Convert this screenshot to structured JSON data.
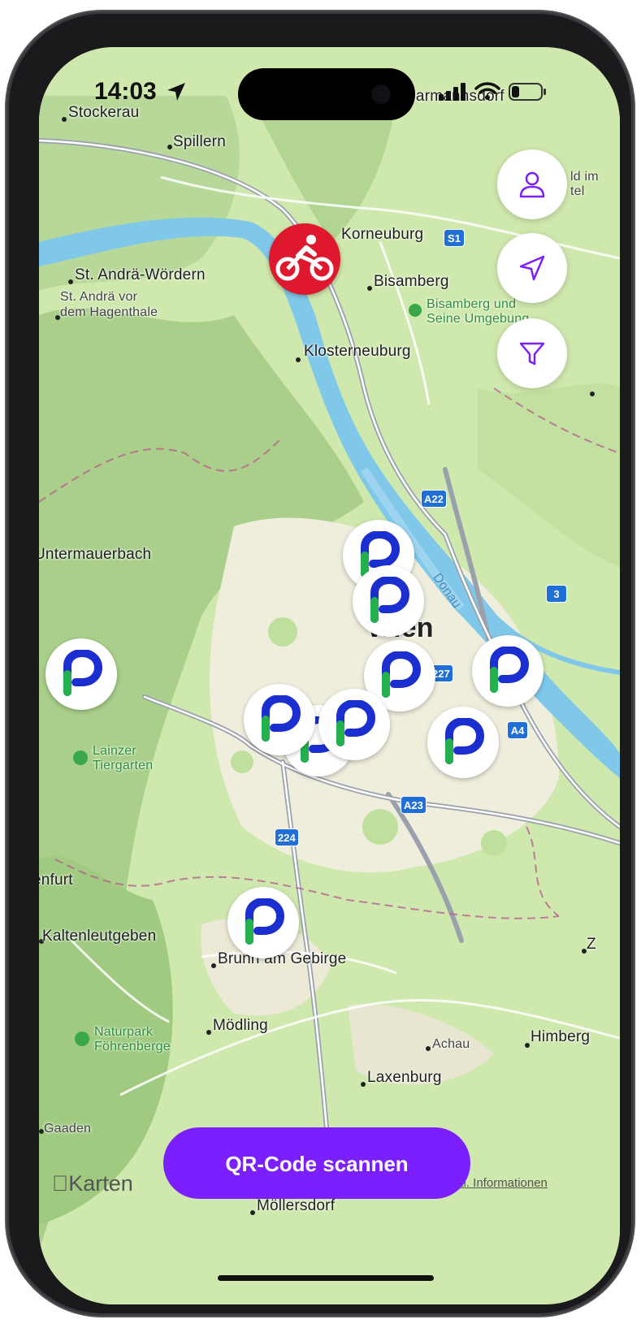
{
  "status_bar": {
    "time": "14:03"
  },
  "map": {
    "places": [
      {
        "id": "stockerau",
        "name": "Stockerau"
      },
      {
        "id": "spillern",
        "name": "Spillern"
      },
      {
        "id": "harmannsdorf",
        "name": "Harmannsdorf"
      },
      {
        "id": "korneuburg",
        "name": "Korneuburg"
      },
      {
        "id": "st-andrae-woerdern",
        "name": "St. Andrä-Wördern"
      },
      {
        "id": "st-andrae-vor",
        "name": "St. Andrä vor"
      },
      {
        "id": "dem-hagenthale",
        "name": "dem Hagenthale"
      },
      {
        "id": "bisamberg",
        "name": "Bisamberg"
      },
      {
        "id": "bisamberg-park-1",
        "name": "Bisamberg und"
      },
      {
        "id": "bisamberg-park-2",
        "name": "Seine Umgebung"
      },
      {
        "id": "klosterneuburg",
        "name": "Klosterneuburg"
      },
      {
        "id": "untermauerbach",
        "name": "Untermauerbach"
      },
      {
        "id": "wien",
        "name": "Wien"
      },
      {
        "id": "donau",
        "name": "Donau"
      },
      {
        "id": "lainzer-1",
        "name": "Lainzer"
      },
      {
        "id": "lainzer-2",
        "name": "Tiergarten"
      },
      {
        "id": "enfurt",
        "name": "enfurt"
      },
      {
        "id": "kaltenleutgeben",
        "name": "Kaltenleutgeben"
      },
      {
        "id": "brunn",
        "name": "Brunn am Gebirge"
      },
      {
        "id": "naturpark-1",
        "name": "Naturpark"
      },
      {
        "id": "naturpark-2",
        "name": "Föhrenberge"
      },
      {
        "id": "moedling",
        "name": "Mödling"
      },
      {
        "id": "achau",
        "name": "Achau"
      },
      {
        "id": "himberg",
        "name": "Himberg"
      },
      {
        "id": "laxenburg",
        "name": "Laxenburg"
      },
      {
        "id": "gaaden",
        "name": "Gaaden"
      },
      {
        "id": "moellersdorf",
        "name": "Möllersdorf"
      },
      {
        "id": "ld-im",
        "name": "ld im"
      },
      {
        "id": "tel",
        "name": "tel"
      },
      {
        "id": "z",
        "name": "Z"
      }
    ],
    "road_shields": [
      "S1",
      "A22",
      "3",
      "227",
      "A4",
      "A23",
      "224"
    ],
    "attribution": "Karten",
    "legal_link": "htl. Informationen"
  },
  "buttons": {
    "profile_icon": "person-icon",
    "locate_icon": "location-arrow-icon",
    "filter_icon": "filter-icon"
  },
  "qr_button": {
    "label": "QR-Code scannen"
  },
  "colors": {
    "accent": "#7b1fff",
    "bike_marker": "#e0182d",
    "logo_blue": "#1b2fd0",
    "logo_green": "#22b14c"
  }
}
